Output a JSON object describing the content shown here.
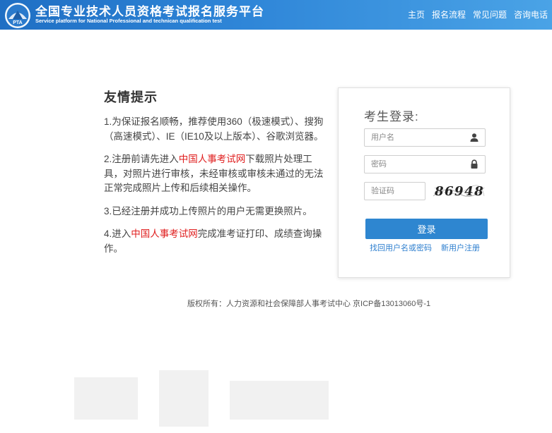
{
  "header": {
    "title": "全国专业技术人员资格考试报名服务平台",
    "subtitle": "Service platform for National Professional and technican qualification test",
    "logo_text": "PTA",
    "nav": [
      "主页",
      "报名流程",
      "常见问题",
      "咨询电话"
    ],
    "background_color": "#2f86d8"
  },
  "notice": {
    "title": "友情提示",
    "items": [
      {
        "before": "1.为保证报名顺畅，推荐使用360（极速模式）、搜狗（高速模式）、IE（IE10及以上版本）、谷歌浏览器。",
        "link": "",
        "after": ""
      },
      {
        "before": "2.注册前请先进入",
        "link": "中国人事考试网",
        "after": "下载照片处理工具，对照片进行审核，未经审核或审核未通过的无法正常完成照片上传和后续相关操作。"
      },
      {
        "before": "3.已经注册并成功上传照片的用户无需更换照片。",
        "link": "",
        "after": ""
      },
      {
        "before": "4.进入",
        "link": "中国人事考试网",
        "after": "完成准考证打印、成绩查询操作。"
      }
    ],
    "link_color": "#e02020"
  },
  "login": {
    "title": "考生登录:",
    "username_placeholder": "用户名",
    "password_placeholder": "密码",
    "captcha_placeholder": "验证码",
    "captcha_text": "86948",
    "submit_label": "登录",
    "recover_link": "找回用户名或密码",
    "register_link": "新用户注册",
    "button_color": "#2e86d0"
  },
  "footer": {
    "copyright": "版权所有：人力资源和社会保障部人事考试中心 京ICP备13013060号-1"
  }
}
